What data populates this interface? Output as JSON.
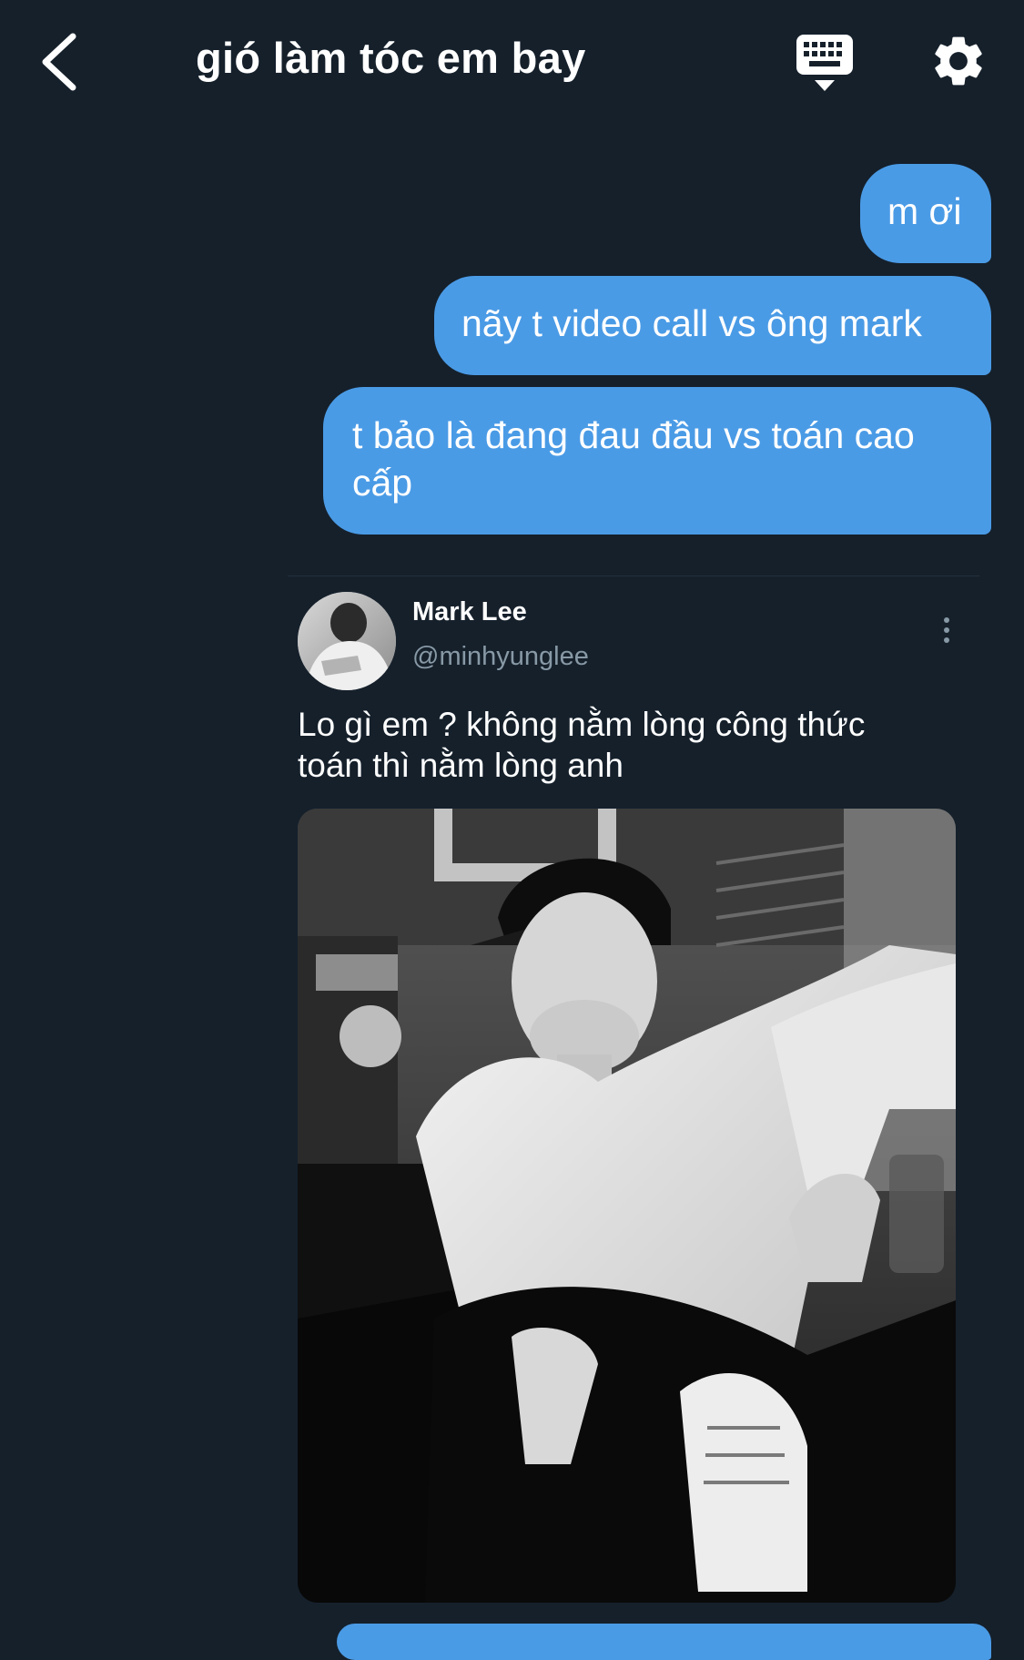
{
  "header": {
    "title": "gió làm tóc em bay",
    "back_icon": "chevron-left-icon",
    "keyboard_icon": "keyboard-icon",
    "settings_icon": "gear-icon"
  },
  "messages": [
    {
      "text": "m ơi"
    },
    {
      "text": "nãy t video call vs ông mark"
    },
    {
      "text": "t bảo là đang đau đầu vs toán cao cấp"
    }
  ],
  "shared_tweet": {
    "author_name": "Mark Lee",
    "author_handle": "@minhyunglee",
    "text": "Lo gì em ? không nằm lòng công thức toán thì nằm lòng anh",
    "more_icon": "more-vertical-icon"
  },
  "colors": {
    "background": "#15202b",
    "bubble": "#4a9be6",
    "muted_text": "#8899a6"
  }
}
